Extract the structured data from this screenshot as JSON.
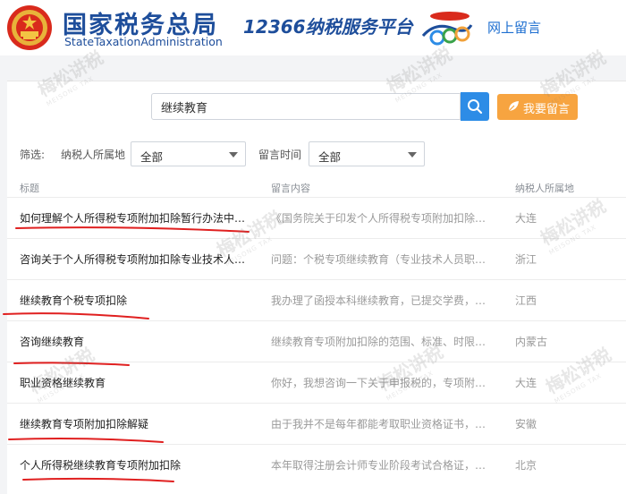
{
  "header": {
    "brand_cn": "国家税务总局",
    "brand_en": "StateTaxationAdministration",
    "platform": "12366纳税服务平台",
    "link": "网上留言"
  },
  "search": {
    "value": "继续教育",
    "leave_message_label": "我要留言"
  },
  "filters": {
    "label": "筛选:",
    "region_label": "纳税人所属地",
    "region_value": "全部",
    "time_label": "留言时间",
    "time_value": "全部"
  },
  "columns": {
    "title": "标题",
    "content": "留言内容",
    "region": "纳税人所属地"
  },
  "rows": [
    {
      "title": "如何理解个人所得税专项附加扣除暂行办法中的...",
      "content": "《国务院关于印发个人所得税专项附加扣除暂行...",
      "region": "大连"
    },
    {
      "title": "咨询关于个人所得税专项附加扣除专业技术人员...",
      "content": "问题：个税专项继续教育（专业技术人员职业资...",
      "region": "浙江"
    },
    {
      "title": "继续教育个税专项扣除",
      "content": "我办理了函授本科继续教育，已提交学费，学期...",
      "region": "江西"
    },
    {
      "title": "咨询继续教育",
      "content": "继续教育专项附加扣除的范围、标准、时限是什...",
      "region": "内蒙古"
    },
    {
      "title": "职业资格继续教育",
      "content": "你好，我想咨询一下关于申报税的，专项附加扣...",
      "region": "大连"
    },
    {
      "title": "继续教育专项附加扣除解疑",
      "content": "由于我并不是每年都能考取职业资格证书，但我...",
      "region": "安徽"
    },
    {
      "title": "个人所得税继续教育专项附加扣除",
      "content": "本年取得注册会计师专业阶段考试合格证，是否...",
      "region": "北京"
    }
  ],
  "watermark": {
    "text": "梅松讲税",
    "sub": "MEISONG TAX"
  },
  "colors": {
    "brand_blue": "#1e4e9b",
    "search_blue": "#2d8ce6",
    "accent_orange": "#f7a440",
    "annotation_red": "#e02020"
  }
}
